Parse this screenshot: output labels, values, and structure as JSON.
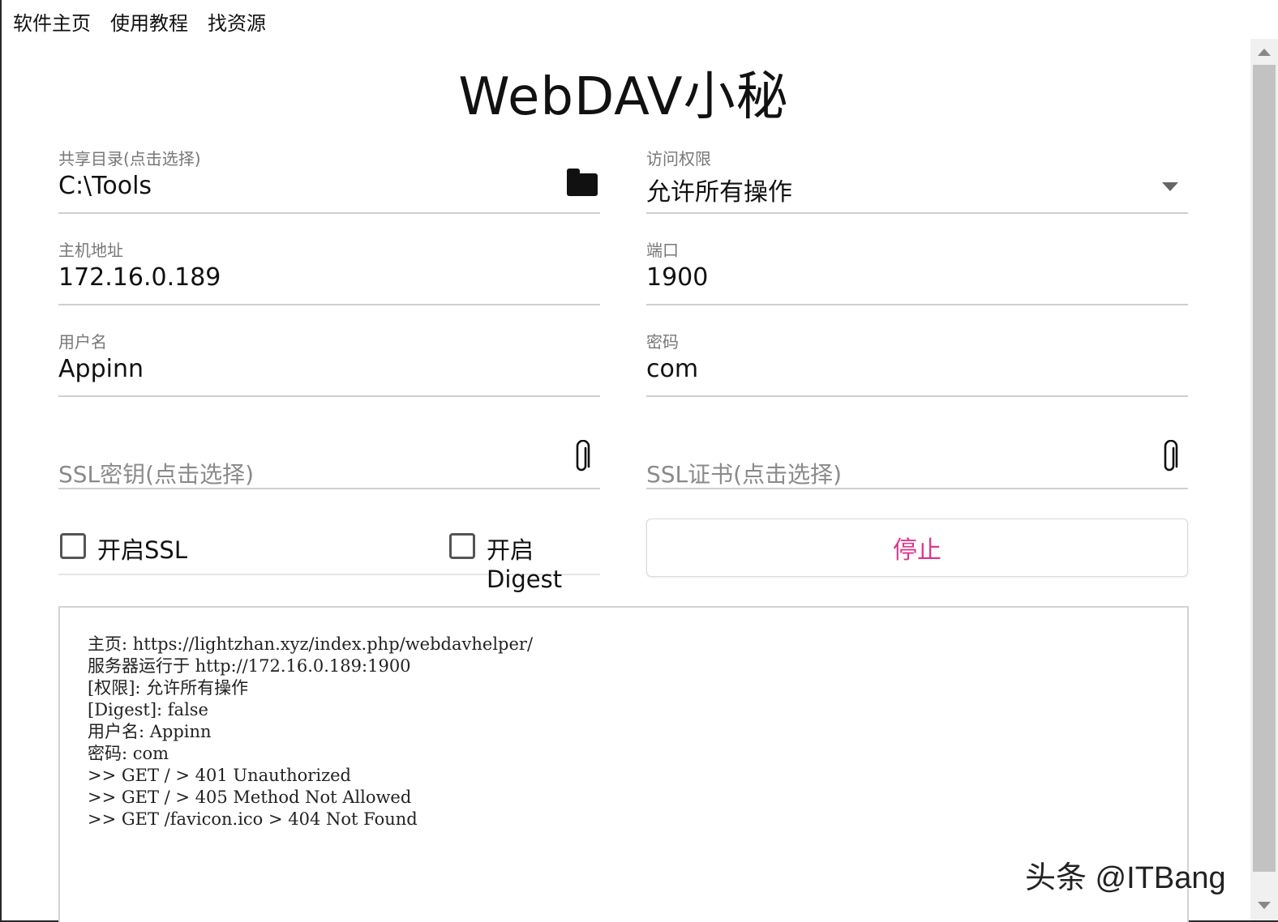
{
  "menu": {
    "home": "软件主页",
    "tutorial": "使用教程",
    "resources": "找资源"
  },
  "app": {
    "title": "WebDAV小秘"
  },
  "form": {
    "share_dir": {
      "label": "共享目录(点击选择)",
      "value": "C:\\Tools",
      "icon": "folder-icon"
    },
    "access": {
      "label": "访问权限",
      "value": "允许所有操作",
      "icon": "chevron-down-icon"
    },
    "host": {
      "label": "主机地址",
      "value": "172.16.0.189"
    },
    "port": {
      "label": "端口",
      "value": "1900"
    },
    "username": {
      "label": "用户名",
      "value": "Appinn"
    },
    "password": {
      "label": "密码",
      "value": "com"
    },
    "ssl_key": {
      "placeholder": "SSL密钥(点击选择)",
      "icon": "paperclip-icon"
    },
    "ssl_cert": {
      "placeholder": "SSL证书(点击选择)",
      "icon": "paperclip-icon"
    },
    "enable_ssl": {
      "label": "开启SSL",
      "checked": false
    },
    "enable_digest": {
      "label": "开启Digest",
      "checked": false
    },
    "stop_button": {
      "label": "停止",
      "color": "#e0358a"
    }
  },
  "log": {
    "lines": [
      "主页: https://lightzhan.xyz/index.php/webdavhelper/",
      "服务器运行于 http://172.16.0.189:1900",
      "[权限]: 允许所有操作",
      "[Digest]: false",
      "用户名: Appinn",
      "密码: com",
      ">> GET / > 401 Unauthorized",
      ">> GET / > 405 Method Not Allowed",
      ">> GET /favicon.ico > 404 Not Found"
    ]
  },
  "watermark": "头条 @ITBang"
}
